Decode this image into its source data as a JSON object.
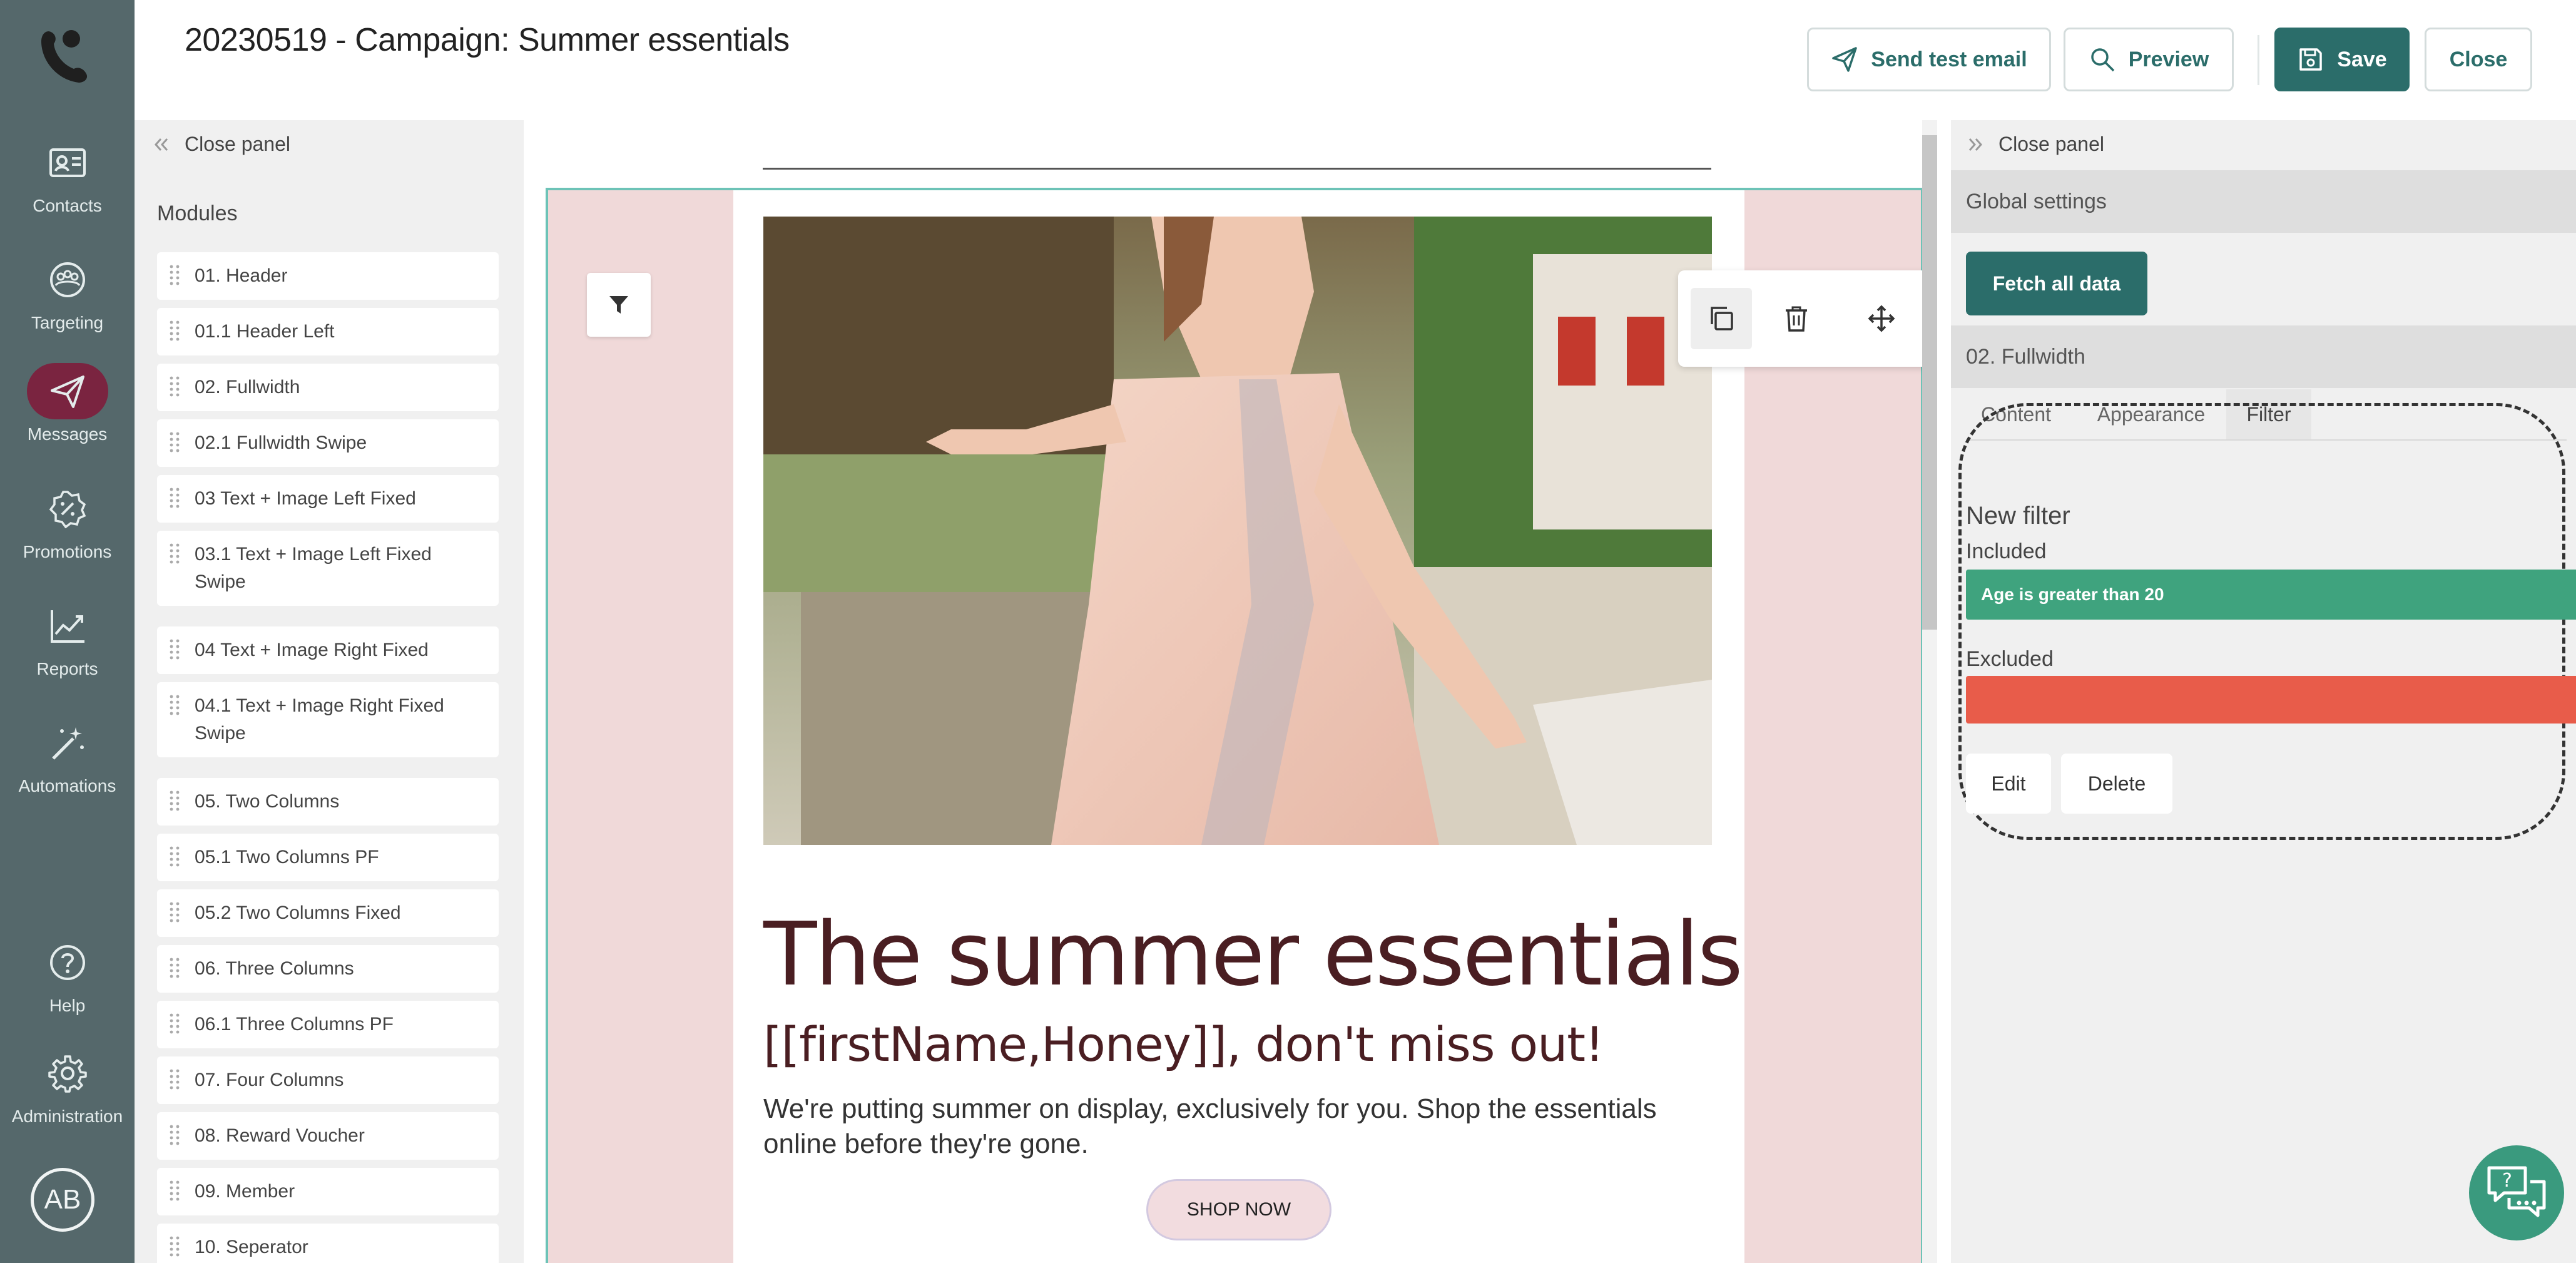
{
  "app": {
    "page_title": "20230519 - Campaign: Summer essentials"
  },
  "nav": {
    "items": [
      {
        "label": "Contacts",
        "icon": "contact-card-icon"
      },
      {
        "label": "Targeting",
        "icon": "people-group-icon"
      },
      {
        "label": "Messages",
        "icon": "paper-plane-icon",
        "active": true
      },
      {
        "label": "Promotions",
        "icon": "percent-badge-icon"
      },
      {
        "label": "Reports",
        "icon": "line-chart-icon"
      },
      {
        "label": "Automations",
        "icon": "magic-wand-icon"
      },
      {
        "label": "Help",
        "icon": "question-circle-icon"
      },
      {
        "label": "Administration",
        "icon": "gear-icon"
      }
    ],
    "avatar_initials": "AB"
  },
  "toolbar": {
    "send_test_label": "Send test email",
    "preview_label": "Preview",
    "save_label": "Save",
    "close_label": "Close"
  },
  "left_panel": {
    "close_label": "Close panel",
    "title": "Modules",
    "modules": [
      "01. Header",
      "01.1 Header Left",
      "02. Fullwidth",
      "02.1 Fullwidth Swipe",
      "03 Text + Image Left Fixed",
      "03.1 Text + Image Left Fixed Swipe",
      "04 Text + Image Right Fixed",
      "04.1 Text + Image Right Fixed Swipe",
      "05. Two Columns",
      "05.1 Two Columns PF",
      "05.2 Two Columns Fixed",
      "06. Three Columns",
      "06.1 Three Columns PF",
      "07. Four Columns",
      "08. Reward Voucher",
      "09. Member",
      "10. Seperator"
    ]
  },
  "email": {
    "headline": "The summer essentials",
    "subheadline": "[[firstName,Honey]], don't miss out!",
    "body": "We're putting summer on display, exclusively for you. Shop the essentials online before they're gone.",
    "cta": "SHOP NOW",
    "hero_image": "woman-in-pink-floral-dress-photo"
  },
  "right_panel": {
    "close_label": "Close panel",
    "global_settings": "Global settings",
    "fetch_label": "Fetch all data",
    "module_name": "02. Fullwidth",
    "tabs": [
      "Content",
      "Appearance",
      "Filter"
    ],
    "active_tab": "Filter",
    "filter": {
      "title": "New filter",
      "included_label": "Included",
      "included_rule": "Age is greater than 20",
      "excluded_label": "Excluded",
      "edit_label": "Edit",
      "delete_label": "Delete"
    }
  },
  "colors": {
    "nav_bg": "#55686b",
    "accent": "#2b6d6a",
    "active_nav": "#7a2440",
    "included": "#3fa37e",
    "excluded": "#e85c4a",
    "headline": "#4a1e22",
    "block_bg": "#f0d9d9"
  }
}
